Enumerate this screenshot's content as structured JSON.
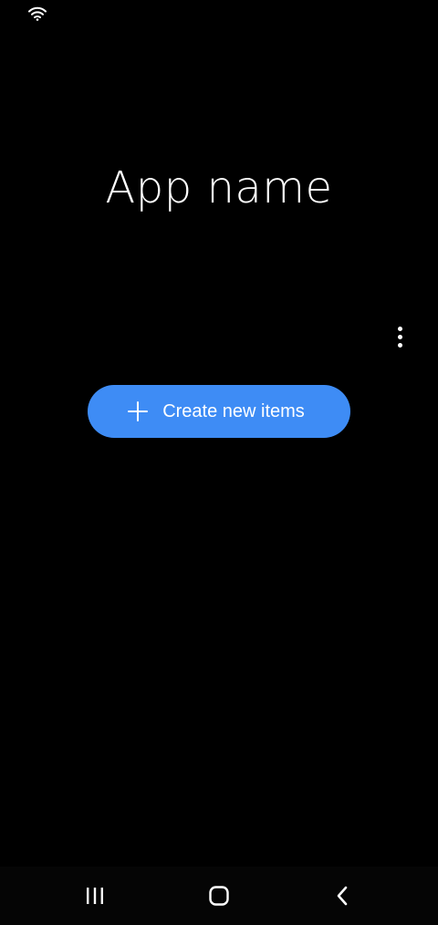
{
  "status_bar": {
    "icons": [
      "wifi-icon"
    ]
  },
  "main": {
    "title": "App name",
    "more_options_icon": "more-vert-icon",
    "create_button": {
      "label": "Create new items",
      "icon": "plus-icon",
      "color": "#3e8cf5"
    }
  },
  "nav_bar": {
    "buttons": [
      "recents-icon",
      "home-icon",
      "back-icon"
    ]
  },
  "colors": {
    "background": "#000000",
    "text": "#ffffff",
    "accent": "#3e8cf5"
  }
}
